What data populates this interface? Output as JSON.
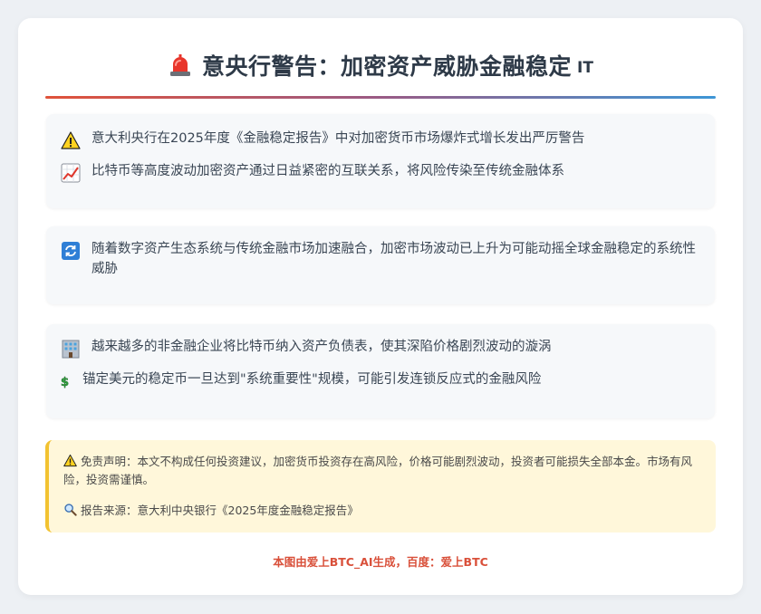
{
  "header": {
    "title": "意央行警告：加密资产威胁金融稳定",
    "suffix": "IT",
    "title_icon": "siren-icon"
  },
  "sections": [
    {
      "items": [
        {
          "icon": "warning-icon",
          "text": "意大利央行在2025年度《金融稳定报告》中对加密货币市场爆炸式增长发出严厉警告"
        },
        {
          "icon": "chart-increasing-icon",
          "text": "比特币等高度波动加密资产通过日益紧密的互联关系，将风险传染至传统金融体系"
        }
      ]
    },
    {
      "items": [
        {
          "icon": "cycle-arrows-icon",
          "text": "随着数字资产生态系统与传统金融市场加速融合，加密市场波动已上升为可能动摇全球金融稳定的系统性威胁"
        }
      ]
    },
    {
      "items": [
        {
          "icon": "office-building-icon",
          "text": "越来越多的非金融企业将比特币纳入资产负债表，使其深陷价格剧烈波动的漩涡"
        },
        {
          "icon": "dollar-sign-icon",
          "text": "锚定美元的稳定币一旦达到\"系统重要性\"规模，可能引发连锁反应式的金融风险"
        }
      ]
    }
  ],
  "notice": {
    "disclaimer": "免责声明：本文不构成任何投资建议，加密货币投资存在高风险，价格可能剧烈波动，投资者可能损失全部本金。市场有风险，投资需谨慎。",
    "source": "报告来源：意大利中央银行《2025年度金融稳定报告》",
    "disclaimer_icon": "warning-icon",
    "source_icon": "magnifier-icon"
  },
  "footer": {
    "text": "本图由爱上BTC_AI生成，百度：爱上BTC"
  },
  "colors": {
    "accent_red": "#d9503a",
    "accent_blue": "#3d96d6",
    "notice_border": "#f2c230",
    "notice_bg": "#fff7da"
  }
}
